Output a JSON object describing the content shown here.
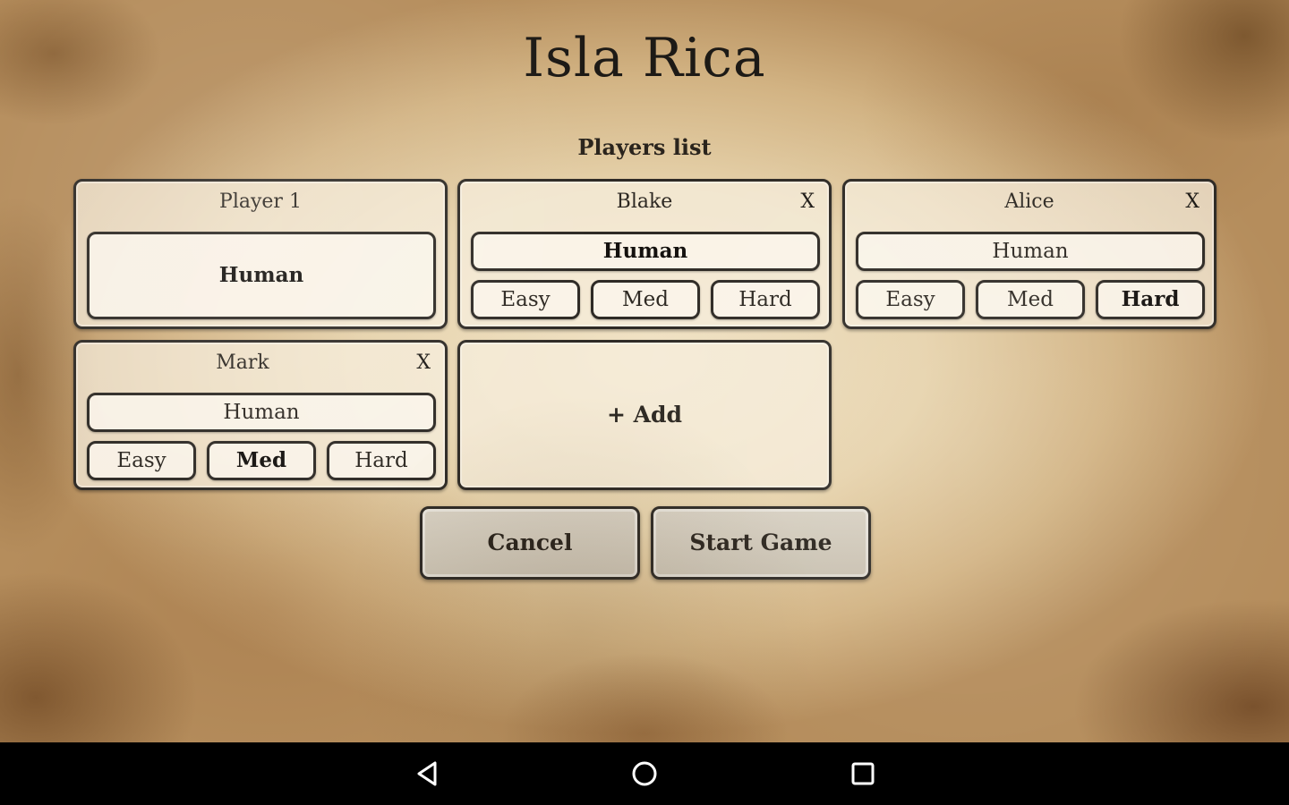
{
  "app": {
    "title": "Isla Rica",
    "subtitle": "Players list"
  },
  "players": [
    {
      "name": "Player 1",
      "type": "Human",
      "removable": false,
      "difficulty_options": []
    },
    {
      "name": "Blake",
      "close": "X",
      "type": "Human",
      "difficulty": {
        "easy": "Easy",
        "med": "Med",
        "hard": "Hard"
      },
      "selected_difficulty": "none"
    },
    {
      "name": "Alice",
      "close": "X",
      "type": "Human",
      "difficulty": {
        "easy": "Easy",
        "med": "Med",
        "hard": "Hard"
      },
      "selected_difficulty": "hard"
    },
    {
      "name": "Mark",
      "close": "X",
      "type": "Human",
      "difficulty": {
        "easy": "Easy",
        "med": "Med",
        "hard": "Hard"
      },
      "selected_difficulty": "med"
    }
  ],
  "add_player": {
    "label": "+ Add"
  },
  "actions": {
    "cancel": "Cancel",
    "start": "Start Game"
  },
  "navbar": {
    "icons": [
      "back-icon",
      "home-icon",
      "recents-icon"
    ]
  },
  "colors": {
    "border": "#2e2a25",
    "text": "#2d2822",
    "parchment": "#e6d2ab"
  }
}
